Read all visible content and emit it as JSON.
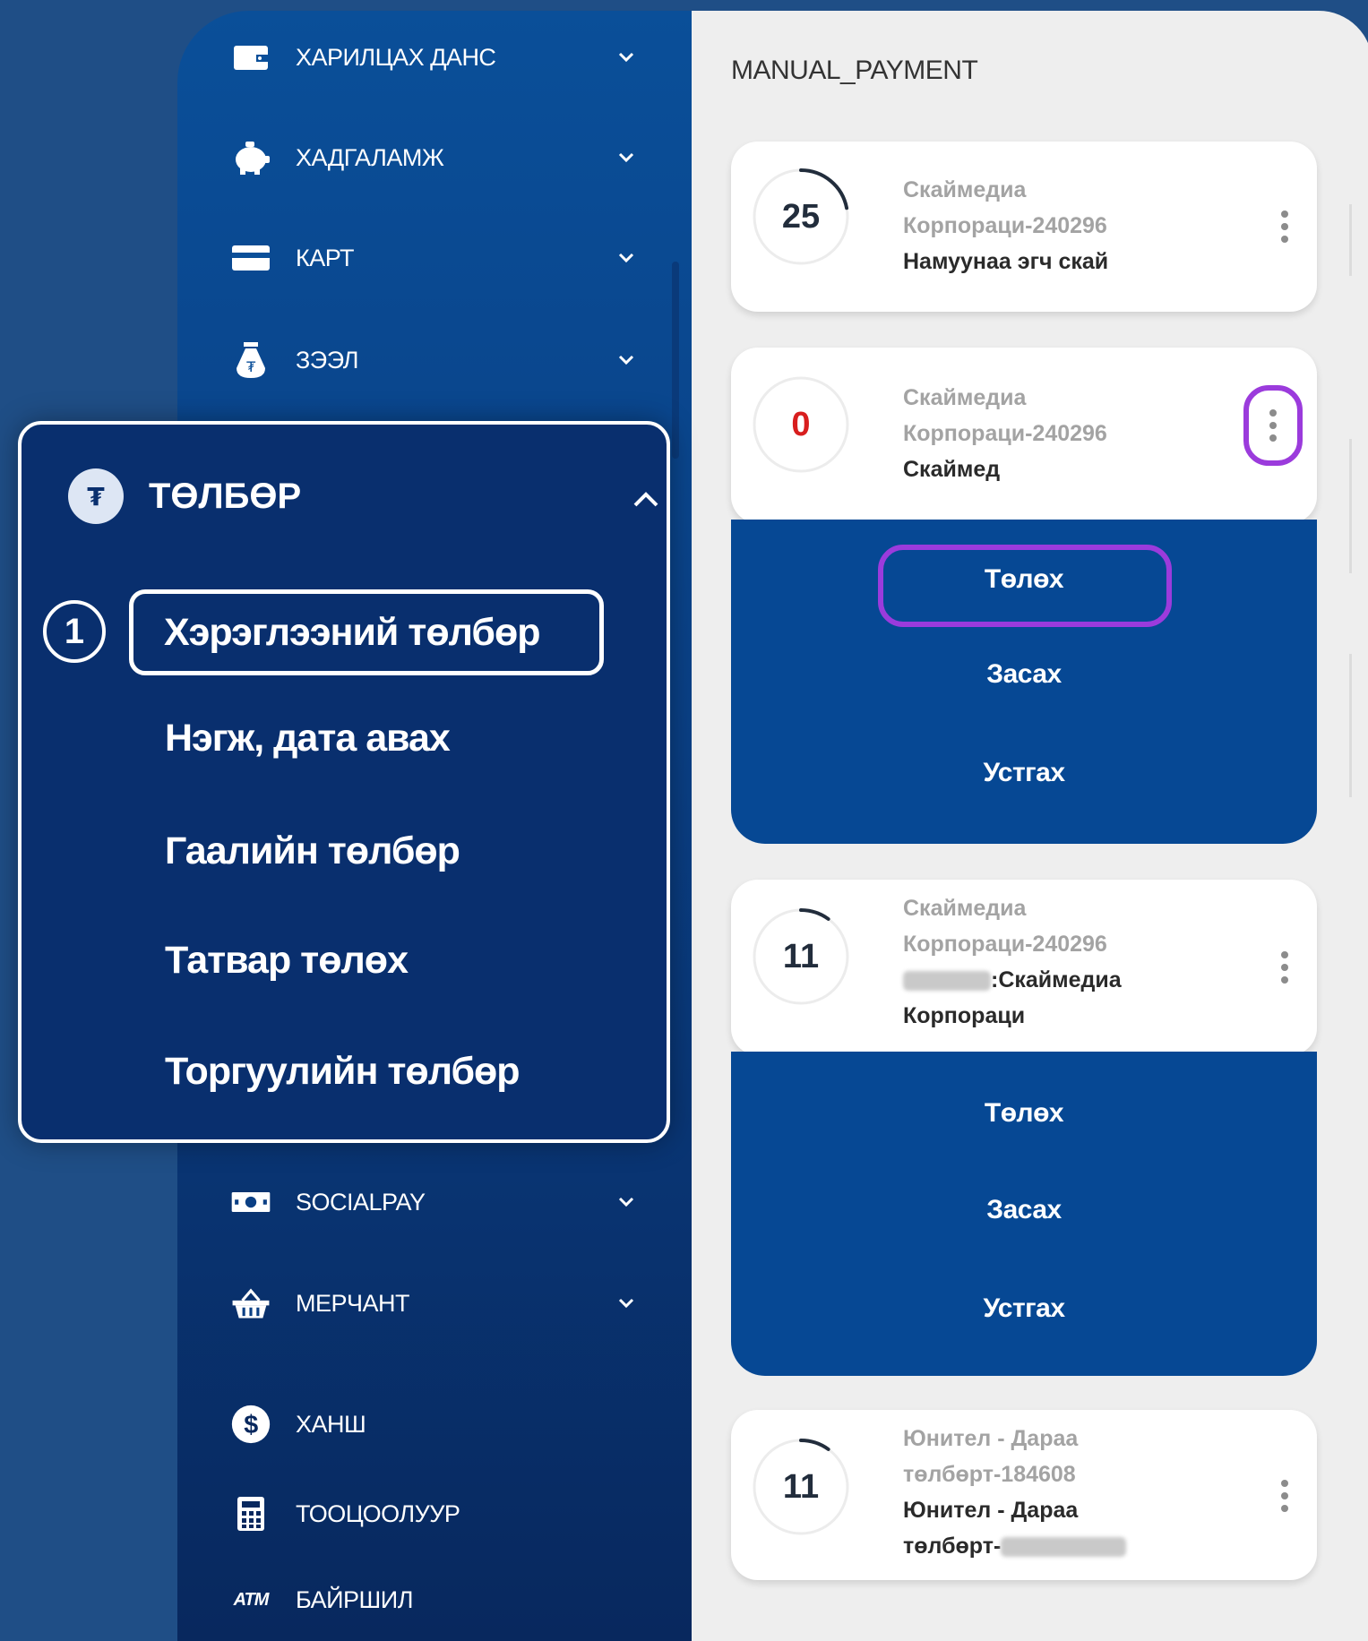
{
  "sidebar": {
    "items_top": [
      {
        "label": "ХАРИЛЦАХ ДАНС",
        "icon": "wallet-icon"
      },
      {
        "label": "ХАДГАЛАМЖ",
        "icon": "piggy-bank-icon"
      },
      {
        "label": "КАРТ",
        "icon": "card-icon"
      },
      {
        "label": "ЗЭЭЛ",
        "icon": "money-bag-icon"
      }
    ],
    "items_bottom": [
      {
        "label": "SOCIALPAY",
        "icon": "cash-icon"
      },
      {
        "label": "МЕРЧАНТ",
        "icon": "basket-icon"
      },
      {
        "label": "ХАНШ",
        "icon": "dollar-icon"
      },
      {
        "label": "ТООЦООЛУУР",
        "icon": "calculator-icon"
      },
      {
        "label": "БАЙРШИЛ",
        "icon": "atm-icon",
        "icon_text": "ATM"
      }
    ]
  },
  "submenu": {
    "title": "ТӨЛБӨР",
    "step": "1",
    "items": [
      "Хэрэглээний төлбөр",
      "Нэгж, дата авах",
      "Гаалийн төлбөр",
      "Татвар төлөх",
      "Торгуулийн төлбөр"
    ]
  },
  "content": {
    "title": "MANUAL_PAYMENT",
    "cards": [
      {
        "count": "25",
        "progress": 0.22,
        "line1": "Скаймедиа",
        "line2": "Корпораци-240296",
        "line3": "Намуунаа эгч скай"
      },
      {
        "count": "0",
        "progress": 0,
        "line1": "Скаймедиа",
        "line2": "Корпораци-240296",
        "line3": "Скаймед"
      },
      {
        "count": "11",
        "progress": 0.1,
        "line1": "Скаймедиа",
        "line2": "Корпораци-240296",
        "line3": ":Скаймедиа",
        "line4": "Корпораци"
      },
      {
        "count": "11",
        "progress": 0.1,
        "line1": "Юнител - Дараа",
        "line2": "төлбөрт-184608",
        "line3": "Юнител - Дараа",
        "line4": "төлбөрт-"
      }
    ],
    "actions": {
      "pay": "Төлөх",
      "edit": "Засах",
      "delete": "Устгах"
    }
  },
  "colors": {
    "highlight": "#9b3bdc",
    "accent": "#064894",
    "danger": "#d81e1e"
  }
}
